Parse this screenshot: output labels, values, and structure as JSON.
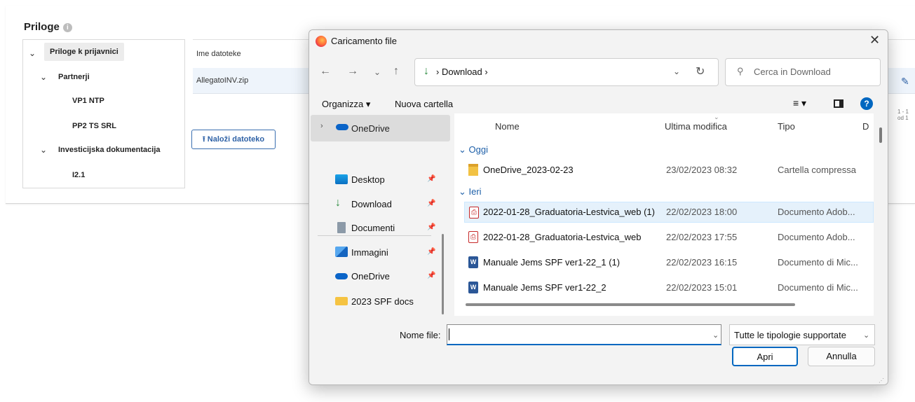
{
  "page": {
    "title": "Priloge",
    "info_icon": "i",
    "tree": [
      {
        "label": "Priloge k prijavnici",
        "expanded": true
      },
      {
        "label": "Partnerji",
        "expanded": true
      },
      {
        "label": "VP1 NTP"
      },
      {
        "label": "PP2 TS SRL"
      },
      {
        "label": "Investicijska dokumentacija",
        "expanded": true
      },
      {
        "label": "I2.1"
      }
    ],
    "files_header": "Ime datoteke",
    "files": [
      "AllegatoINV.zip"
    ],
    "upload_label": "Naloži datoteko",
    "pager_text": "1 - 1 od 1",
    "accent": "#2f62a6"
  },
  "dialog": {
    "title": "Caricamento file",
    "path": "Download",
    "search_placeholder": "Cerca in Download",
    "toolbar": {
      "organize": "Organizza ▾",
      "new_folder": "Nuova cartella"
    },
    "sidebar": {
      "top": "OneDrive",
      "items": [
        {
          "label": "Desktop",
          "icon": "desktop-icon",
          "pinned": true
        },
        {
          "label": "Download",
          "icon": "download-icon",
          "pinned": true
        },
        {
          "label": "Documenti",
          "icon": "documents-icon",
          "pinned": true
        },
        {
          "label": "Immagini",
          "icon": "pictures-icon",
          "pinned": true
        },
        {
          "label": "OneDrive",
          "icon": "onedrive-icon",
          "pinned": true
        },
        {
          "label": "2023 SPF docs",
          "icon": "folder-icon",
          "pinned": false
        }
      ]
    },
    "columns": {
      "name": "Nome",
      "modified": "Ultima modifica",
      "type": "Tipo",
      "size": "D"
    },
    "groups": [
      {
        "label": "Oggi",
        "files": [
          {
            "name": "OneDrive_2023-02-23",
            "modified": "23/02/2023 08:32",
            "type": "Cartella compressa",
            "icon": "zip"
          }
        ]
      },
      {
        "label": "Ieri",
        "files": [
          {
            "name": "2022-01-28_Graduatoria-Lestvica_web (1)",
            "modified": "22/02/2023 18:00",
            "type": "Documento Adob...",
            "icon": "pdf",
            "selected": true
          },
          {
            "name": "2022-01-28_Graduatoria-Lestvica_web",
            "modified": "22/02/2023 17:55",
            "type": "Documento Adob...",
            "icon": "pdf"
          },
          {
            "name": "Manuale Jems SPF ver1-22_1 (1)",
            "modified": "22/02/2023 16:15",
            "type": "Documento di Mic...",
            "icon": "word"
          },
          {
            "name": "Manuale Jems SPF ver1-22_2",
            "modified": "22/02/2023 15:01",
            "type": "Documento di Mic...",
            "icon": "word"
          }
        ]
      }
    ],
    "filename_label": "Nome file:",
    "filename_value": "",
    "filetype": "Tutte le tipologie supportate",
    "open_label": "Apri",
    "cancel_label": "Annulla"
  }
}
